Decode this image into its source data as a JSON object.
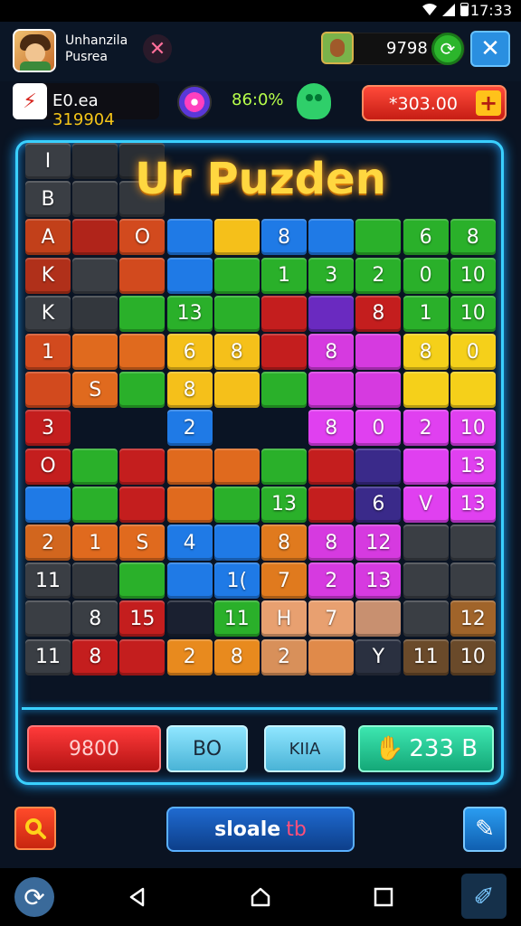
{
  "status_bar": {
    "time": "17:33"
  },
  "header": {
    "game_name_line1": "Unhanzila",
    "game_name_line2": "Pusrea",
    "coins": "9798"
  },
  "stats": {
    "score_prefix": "E0.ea",
    "score_value": "319904",
    "percent": "86:0%",
    "red_pill_value": "*303.00"
  },
  "board": {
    "title": "Ur Puzden"
  },
  "actions": {
    "red_label": "9800",
    "blue1_label": "BO",
    "blue2_label": "KIIA",
    "green_label": "233 B"
  },
  "bottom": {
    "main_label": "sloale",
    "main_suffix": "tb"
  },
  "tiles": [
    {
      "r": 0,
      "c": 0,
      "color": "#3a3e44",
      "t": "I"
    },
    {
      "r": 0,
      "c": 1,
      "color": "#2a2e34",
      "t": ""
    },
    {
      "r": 0,
      "c": 2,
      "color": "#2a2e34",
      "t": ""
    },
    {
      "r": 1,
      "c": 0,
      "color": "#3a3e44",
      "t": "B"
    },
    {
      "r": 1,
      "c": 1,
      "color": "#33373d",
      "t": ""
    },
    {
      "r": 1,
      "c": 2,
      "color": "#33373d",
      "t": ""
    },
    {
      "r": 2,
      "c": 0,
      "color": "#c2401a",
      "t": "A"
    },
    {
      "r": 2,
      "c": 1,
      "color": "#b0241a",
      "t": ""
    },
    {
      "r": 2,
      "c": 2,
      "color": "#d24a1e",
      "t": "O"
    },
    {
      "r": 2,
      "c": 3,
      "color": "#1f7ae6",
      "t": ""
    },
    {
      "r": 2,
      "c": 4,
      "color": "#f5c01a",
      "t": ""
    },
    {
      "r": 2,
      "c": 5,
      "color": "#1f7ae6",
      "t": "8"
    },
    {
      "r": 2,
      "c": 6,
      "color": "#1f7ae6",
      "t": ""
    },
    {
      "r": 2,
      "c": 7,
      "color": "#2ab02a",
      "t": ""
    },
    {
      "r": 2,
      "c": 8,
      "color": "#2ab02a",
      "t": "6"
    },
    {
      "r": 2,
      "c": 9,
      "color": "#2ab02a",
      "t": "8"
    },
    {
      "r": 3,
      "c": 0,
      "color": "#b0301a",
      "t": "K"
    },
    {
      "r": 3,
      "c": 1,
      "color": "#3a3e44",
      "t": ""
    },
    {
      "r": 3,
      "c": 2,
      "color": "#d24a1e",
      "t": ""
    },
    {
      "r": 3,
      "c": 3,
      "color": "#1f7ae6",
      "t": ""
    },
    {
      "r": 3,
      "c": 4,
      "color": "#2ab02a",
      "t": ""
    },
    {
      "r": 3,
      "c": 5,
      "color": "#2ab02a",
      "t": "1"
    },
    {
      "r": 3,
      "c": 6,
      "color": "#2ab02a",
      "t": "3"
    },
    {
      "r": 3,
      "c": 7,
      "color": "#2ab02a",
      "t": "2"
    },
    {
      "r": 3,
      "c": 8,
      "color": "#2ab02a",
      "t": "0"
    },
    {
      "r": 3,
      "c": 9,
      "color": "#2ab02a",
      "t": "10"
    },
    {
      "r": 4,
      "c": 0,
      "color": "#3a3e44",
      "t": "K"
    },
    {
      "r": 4,
      "c": 1,
      "color": "#33373d",
      "t": ""
    },
    {
      "r": 4,
      "c": 2,
      "color": "#2ab02a",
      "t": ""
    },
    {
      "r": 4,
      "c": 3,
      "color": "#2ab02a",
      "t": "13"
    },
    {
      "r": 4,
      "c": 4,
      "color": "#2ab02a",
      "t": ""
    },
    {
      "r": 4,
      "c": 5,
      "color": "#c41e1e",
      "t": ""
    },
    {
      "r": 4,
      "c": 6,
      "color": "#6a2ac0",
      "t": ""
    },
    {
      "r": 4,
      "c": 7,
      "color": "#c41e1e",
      "t": "8"
    },
    {
      "r": 4,
      "c": 8,
      "color": "#2ab02a",
      "t": "1"
    },
    {
      "r": 4,
      "c": 9,
      "color": "#2ab02a",
      "t": "10"
    },
    {
      "r": 5,
      "c": 0,
      "color": "#d24a1e",
      "t": "1"
    },
    {
      "r": 5,
      "c": 1,
      "color": "#e06a1e",
      "t": ""
    },
    {
      "r": 5,
      "c": 2,
      "color": "#e06a1e",
      "t": ""
    },
    {
      "r": 5,
      "c": 3,
      "color": "#f5c01a",
      "t": "6"
    },
    {
      "r": 5,
      "c": 4,
      "color": "#f5c01a",
      "t": "8"
    },
    {
      "r": 5,
      "c": 5,
      "color": "#c41e1e",
      "t": ""
    },
    {
      "r": 5,
      "c": 6,
      "color": "#d63ae0",
      "t": "8"
    },
    {
      "r": 5,
      "c": 7,
      "color": "#d63ae0",
      "t": ""
    },
    {
      "r": 5,
      "c": 8,
      "color": "#f5d01a",
      "t": "8"
    },
    {
      "r": 5,
      "c": 9,
      "color": "#f5d01a",
      "t": "0"
    },
    {
      "r": 6,
      "c": 0,
      "color": "#d24a1e",
      "t": ""
    },
    {
      "r": 6,
      "c": 1,
      "color": "#e06a1e",
      "t": "S"
    },
    {
      "r": 6,
      "c": 2,
      "color": "#2ab02a",
      "t": ""
    },
    {
      "r": 6,
      "c": 3,
      "color": "#f5c01a",
      "t": "8"
    },
    {
      "r": 6,
      "c": 4,
      "color": "#f5c01a",
      "t": ""
    },
    {
      "r": 6,
      "c": 5,
      "color": "#2ab02a",
      "t": ""
    },
    {
      "r": 6,
      "c": 6,
      "color": "#d63ae0",
      "t": ""
    },
    {
      "r": 6,
      "c": 7,
      "color": "#d63ae0",
      "t": ""
    },
    {
      "r": 6,
      "c": 8,
      "color": "#f5d01a",
      "t": ""
    },
    {
      "r": 6,
      "c": 9,
      "color": "#f5d01a",
      "t": ""
    },
    {
      "r": 7,
      "c": 0,
      "color": "#c41e1e",
      "t": "3"
    },
    {
      "r": 7,
      "c": 3,
      "color": "#1f7ae6",
      "t": "2"
    },
    {
      "r": 7,
      "c": 6,
      "color": "#e040f0",
      "t": "8"
    },
    {
      "r": 7,
      "c": 7,
      "color": "#e040f0",
      "t": "0"
    },
    {
      "r": 7,
      "c": 8,
      "color": "#e040f0",
      "t": "2"
    },
    {
      "r": 7,
      "c": 9,
      "color": "#e040f0",
      "t": "10"
    },
    {
      "r": 8,
      "c": 0,
      "color": "#c41e1e",
      "t": "O"
    },
    {
      "r": 8,
      "c": 1,
      "color": "#2ab02a",
      "t": ""
    },
    {
      "r": 8,
      "c": 2,
      "color": "#c41e1e",
      "t": ""
    },
    {
      "r": 8,
      "c": 3,
      "color": "#e06a1e",
      "t": ""
    },
    {
      "r": 8,
      "c": 4,
      "color": "#e06a1e",
      "t": ""
    },
    {
      "r": 8,
      "c": 5,
      "color": "#2ab02a",
      "t": ""
    },
    {
      "r": 8,
      "c": 6,
      "color": "#c41e1e",
      "t": ""
    },
    {
      "r": 8,
      "c": 7,
      "color": "#3a2a8a",
      "t": ""
    },
    {
      "r": 8,
      "c": 8,
      "color": "#e040f0",
      "t": ""
    },
    {
      "r": 8,
      "c": 9,
      "color": "#e040f0",
      "t": "13"
    },
    {
      "r": 9,
      "c": 0,
      "color": "#1f7ae6",
      "t": ""
    },
    {
      "r": 9,
      "c": 1,
      "color": "#2ab02a",
      "t": ""
    },
    {
      "r": 9,
      "c": 2,
      "color": "#c41e1e",
      "t": ""
    },
    {
      "r": 9,
      "c": 3,
      "color": "#e06a1e",
      "t": ""
    },
    {
      "r": 9,
      "c": 4,
      "color": "#2ab02a",
      "t": ""
    },
    {
      "r": 9,
      "c": 5,
      "color": "#2ab02a",
      "t": "13"
    },
    {
      "r": 9,
      "c": 6,
      "color": "#c41e1e",
      "t": ""
    },
    {
      "r": 9,
      "c": 7,
      "color": "#3a2a8a",
      "t": "6"
    },
    {
      "r": 9,
      "c": 8,
      "color": "#e040f0",
      "t": "V"
    },
    {
      "r": 9,
      "c": 9,
      "color": "#e040f0",
      "t": "13"
    },
    {
      "r": 10,
      "c": 0,
      "color": "#d2661e",
      "t": "2"
    },
    {
      "r": 10,
      "c": 1,
      "color": "#e06a1e",
      "t": "1"
    },
    {
      "r": 10,
      "c": 2,
      "color": "#e06a1e",
      "t": "S"
    },
    {
      "r": 10,
      "c": 3,
      "color": "#1f7ae6",
      "t": "4"
    },
    {
      "r": 10,
      "c": 4,
      "color": "#1f7ae6",
      "t": ""
    },
    {
      "r": 10,
      "c": 5,
      "color": "#e07a1e",
      "t": "8"
    },
    {
      "r": 10,
      "c": 6,
      "color": "#d63ae0",
      "t": "8"
    },
    {
      "r": 10,
      "c": 7,
      "color": "#d63ae0",
      "t": "12"
    },
    {
      "r": 10,
      "c": 8,
      "color": "#3a3e44",
      "t": ""
    },
    {
      "r": 10,
      "c": 9,
      "color": "#3a3e44",
      "t": ""
    },
    {
      "r": 11,
      "c": 0,
      "color": "#3a3e44",
      "t": "11"
    },
    {
      "r": 11,
      "c": 1,
      "color": "#33373d",
      "t": ""
    },
    {
      "r": 11,
      "c": 2,
      "color": "#2ab02a",
      "t": ""
    },
    {
      "r": 11,
      "c": 3,
      "color": "#1f7ae6",
      "t": ""
    },
    {
      "r": 11,
      "c": 4,
      "color": "#1f7ae6",
      "t": "1("
    },
    {
      "r": 11,
      "c": 5,
      "color": "#e07a1e",
      "t": "7"
    },
    {
      "r": 11,
      "c": 6,
      "color": "#d63ae0",
      "t": "2"
    },
    {
      "r": 11,
      "c": 7,
      "color": "#d63ae0",
      "t": "13"
    },
    {
      "r": 11,
      "c": 8,
      "color": "#3a3e44",
      "t": ""
    },
    {
      "r": 11,
      "c": 9,
      "color": "#3a3e44",
      "t": ""
    },
    {
      "r": 12,
      "c": 0,
      "color": "#3a3e44",
      "t": ""
    },
    {
      "r": 12,
      "c": 1,
      "color": "#3a3e44",
      "t": "8"
    },
    {
      "r": 12,
      "c": 2,
      "color": "#c41e1e",
      "t": "15"
    },
    {
      "r": 12,
      "c": 3,
      "color": "#1a2030",
      "t": ""
    },
    {
      "r": 12,
      "c": 4,
      "color": "#2ab02a",
      "t": "11"
    },
    {
      "r": 12,
      "c": 5,
      "color": "#e8a070",
      "t": "H"
    },
    {
      "r": 12,
      "c": 6,
      "color": "#e8a070",
      "t": "7"
    },
    {
      "r": 12,
      "c": 7,
      "color": "#c89070",
      "t": ""
    },
    {
      "r": 12,
      "c": 8,
      "color": "#3a3e44",
      "t": ""
    },
    {
      "r": 12,
      "c": 9,
      "color": "#a0642a",
      "t": "12"
    },
    {
      "r": 13,
      "c": 0,
      "color": "#3a3e44",
      "t": "11"
    },
    {
      "r": 13,
      "c": 1,
      "color": "#c41e1e",
      "t": "8"
    },
    {
      "r": 13,
      "c": 2,
      "color": "#c41e1e",
      "t": ""
    },
    {
      "r": 13,
      "c": 3,
      "color": "#e88a1e",
      "t": "2"
    },
    {
      "r": 13,
      "c": 4,
      "color": "#e88a1e",
      "t": "8"
    },
    {
      "r": 13,
      "c": 5,
      "color": "#d8905a",
      "t": "2"
    },
    {
      "r": 13,
      "c": 6,
      "color": "#e08a4a",
      "t": ""
    },
    {
      "r": 13,
      "c": 7,
      "color": "#2a3040",
      "t": "Y"
    },
    {
      "r": 13,
      "c": 8,
      "color": "#6a4a2a",
      "t": "11"
    },
    {
      "r": 13,
      "c": 9,
      "color": "#6a4a2a",
      "t": "10"
    }
  ]
}
